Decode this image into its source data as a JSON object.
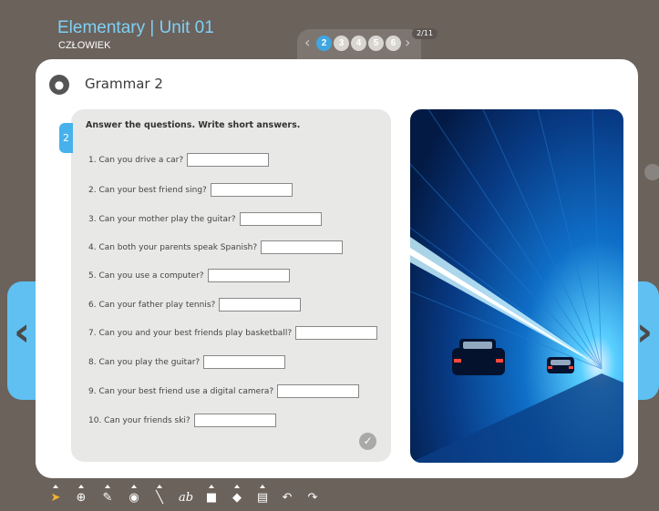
{
  "header": {
    "title": "Elementary | Unit 01",
    "subtitle": "CZŁOWIEK"
  },
  "pager": {
    "pages": [
      "2",
      "3",
      "4",
      "5",
      "6"
    ],
    "active_page": "2",
    "page_count": "2/11"
  },
  "card": {
    "title": "Grammar 2",
    "icon": "owl-icon"
  },
  "exercise": {
    "number": "2",
    "instruction": "Answer the questions. Write short answers.",
    "questions": [
      "1. Can you drive a car?",
      "2. Can your best friend sing?",
      "3. Can your mother play the guitar?",
      "4. Can both your parents speak Spanish?",
      "5. Can you use a computer?",
      "6. Can your father play tennis?",
      "7. Can you and your best friends play basketball?",
      "8. Can you play the guitar?",
      "9. Can your best friend use a digital camera?",
      "10. Can your friends ski?"
    ],
    "answers": [
      "",
      "",
      "",
      "",
      "",
      "",
      "",
      "",
      "",
      ""
    ]
  },
  "navigation": {
    "prev_icon": "chevron-left-icon",
    "next_icon": "chevron-right-icon"
  },
  "toolbar": {
    "tools": [
      "pointer-icon",
      "zoom-icon",
      "pen-icon",
      "fill-icon",
      "line-icon",
      "text-icon",
      "rectangle-icon",
      "eraser-icon",
      "note-icon",
      "undo-icon",
      "redo-icon"
    ]
  },
  "colors": {
    "accent": "#47b1eb",
    "title": "#7fd0f5",
    "background": "#6b625c"
  }
}
